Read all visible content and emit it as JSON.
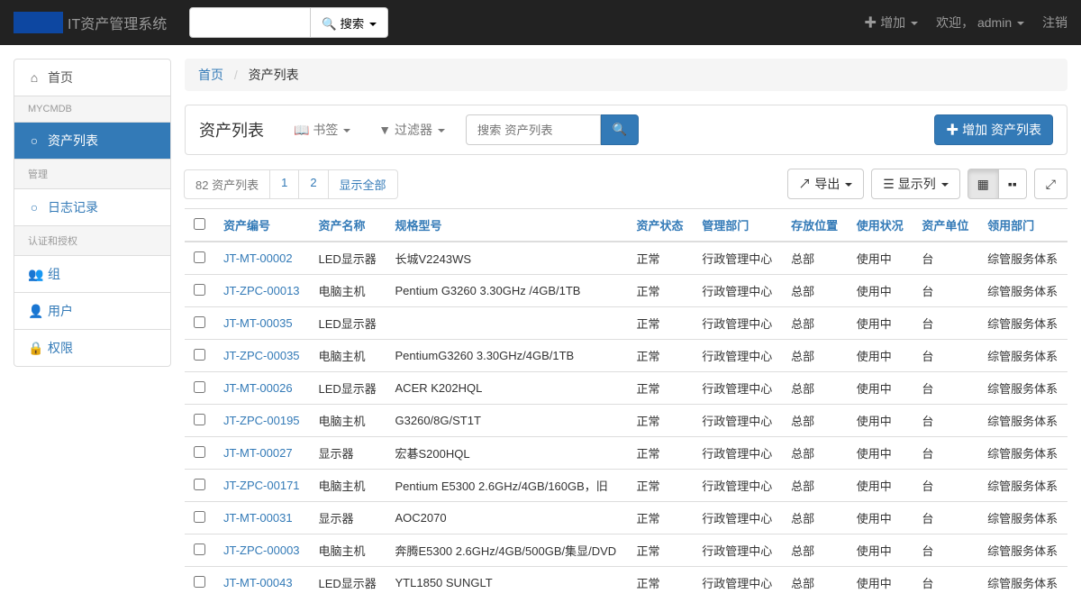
{
  "navbar": {
    "brand": "IT资产管理系统",
    "search_btn": "搜索",
    "add": "增加",
    "welcome": "欢迎，",
    "user": "admin",
    "logout": "注销"
  },
  "sidebar": {
    "home": "首页",
    "section1": "MYCMDB",
    "asset_list": "资产列表",
    "section2": "管理",
    "log": "日志记录",
    "section3": "认证和授权",
    "group": "组",
    "user": "用户",
    "perm": "权限"
  },
  "breadcrumb": {
    "home": "首页",
    "current": "资产列表"
  },
  "toolbar": {
    "title": "资产列表",
    "bookmark": "书签",
    "filter": "过滤器",
    "search_placeholder": "搜索 资产列表",
    "add_btn": "增加 资产列表"
  },
  "actions": {
    "count": "82 资产列表",
    "page1": "1",
    "page2": "2",
    "show_all": "显示全部",
    "export": "导出",
    "columns": "显示列"
  },
  "table": {
    "headers": {
      "asset_no": "资产编号",
      "asset_name": "资产名称",
      "spec": "规格型号",
      "status": "资产状态",
      "dept": "管理部门",
      "location": "存放位置",
      "usage": "使用状况",
      "unit": "资产单位",
      "receive_dept": "领用部门"
    },
    "rows": [
      {
        "no": "JT-MT-00002",
        "name": "LED显示器",
        "spec": "长城V2243WS",
        "status": "正常",
        "dept": "行政管理中心",
        "loc": "总部",
        "usage": "使用中",
        "unit": "台",
        "rdept": "综管服务体系"
      },
      {
        "no": "JT-ZPC-00013",
        "name": "电脑主机",
        "spec": "Pentium G3260 3.30GHz /4GB/1TB",
        "status": "正常",
        "dept": "行政管理中心",
        "loc": "总部",
        "usage": "使用中",
        "unit": "台",
        "rdept": "综管服务体系"
      },
      {
        "no": "JT-MT-00035",
        "name": "LED显示器",
        "spec": "",
        "status": "正常",
        "dept": "行政管理中心",
        "loc": "总部",
        "usage": "使用中",
        "unit": "台",
        "rdept": "综管服务体系"
      },
      {
        "no": "JT-ZPC-00035",
        "name": "电脑主机",
        "spec": "PentiumG3260 3.30GHz/4GB/1TB",
        "status": "正常",
        "dept": "行政管理中心",
        "loc": "总部",
        "usage": "使用中",
        "unit": "台",
        "rdept": "综管服务体系"
      },
      {
        "no": "JT-MT-00026",
        "name": "LED显示器",
        "spec": "ACER K202HQL",
        "status": "正常",
        "dept": "行政管理中心",
        "loc": "总部",
        "usage": "使用中",
        "unit": "台",
        "rdept": "综管服务体系"
      },
      {
        "no": "JT-ZPC-00195",
        "name": "电脑主机",
        "spec": "G3260/8G/ST1T",
        "status": "正常",
        "dept": "行政管理中心",
        "loc": "总部",
        "usage": "使用中",
        "unit": "台",
        "rdept": "综管服务体系"
      },
      {
        "no": "JT-MT-00027",
        "name": "显示器",
        "spec": "宏碁S200HQL",
        "status": "正常",
        "dept": "行政管理中心",
        "loc": "总部",
        "usage": "使用中",
        "unit": "台",
        "rdept": "综管服务体系"
      },
      {
        "no": "JT-ZPC-00171",
        "name": "电脑主机",
        "spec": "Pentium E5300 2.6GHz/4GB/160GB，旧",
        "status": "正常",
        "dept": "行政管理中心",
        "loc": "总部",
        "usage": "使用中",
        "unit": "台",
        "rdept": "综管服务体系"
      },
      {
        "no": "JT-MT-00031",
        "name": "显示器",
        "spec": "AOC2070",
        "status": "正常",
        "dept": "行政管理中心",
        "loc": "总部",
        "usage": "使用中",
        "unit": "台",
        "rdept": "综管服务体系"
      },
      {
        "no": "JT-ZPC-00003",
        "name": "电脑主机",
        "spec": "奔腾E5300 2.6GHz/4GB/500GB/集显/DVD",
        "status": "正常",
        "dept": "行政管理中心",
        "loc": "总部",
        "usage": "使用中",
        "unit": "台",
        "rdept": "综管服务体系"
      },
      {
        "no": "JT-MT-00043",
        "name": "LED显示器",
        "spec": "YTL1850 SUNGLT",
        "status": "正常",
        "dept": "行政管理中心",
        "loc": "总部",
        "usage": "使用中",
        "unit": "台",
        "rdept": "综管服务体系"
      }
    ]
  }
}
